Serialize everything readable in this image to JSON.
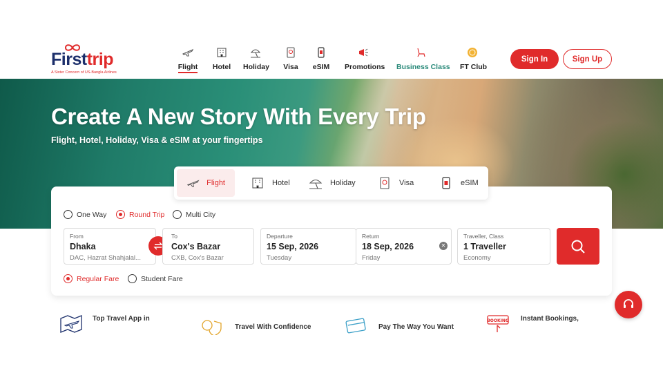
{
  "colors": {
    "brand_red": "#e02b2b",
    "brand_navy": "#1c2f6b",
    "business_teal": "#2a8a7a"
  },
  "brand": {
    "name_first": "First",
    "name_trip": "trip",
    "tagline": "A Sister Concern of US-Bangla Airlines"
  },
  "nav": {
    "items": [
      {
        "label": "Flight",
        "icon": "plane-icon"
      },
      {
        "label": "Hotel",
        "icon": "hotel-icon"
      },
      {
        "label": "Holiday",
        "icon": "beach-icon"
      },
      {
        "label": "Visa",
        "icon": "passport-icon"
      },
      {
        "label": "eSIM",
        "icon": "sim-icon"
      },
      {
        "label": "Promotions",
        "icon": "megaphone-icon"
      },
      {
        "label": "Business Class",
        "icon": "seat-icon"
      },
      {
        "label": "FT Club",
        "icon": "coin-icon"
      }
    ],
    "active": "Flight"
  },
  "auth": {
    "sign_in": "Sign In",
    "sign_up": "Sign Up"
  },
  "hero": {
    "title": "Create A New Story With Every Trip",
    "subtitle": "Flight, Hotel, Holiday, Visa & eSIM at your fingertips"
  },
  "search": {
    "tabs": [
      {
        "label": "Flight",
        "icon": "plane-icon"
      },
      {
        "label": "Hotel",
        "icon": "hotel-icon"
      },
      {
        "label": "Holiday",
        "icon": "beach-icon"
      },
      {
        "label": "Visa",
        "icon": "passport-icon"
      },
      {
        "label": "eSIM",
        "icon": "sim-icon"
      }
    ],
    "active_tab": "Flight",
    "trip_types": [
      "One Way",
      "Round Trip",
      "Multi City"
    ],
    "selected_trip_type": "Round Trip",
    "from": {
      "caption": "From",
      "city": "Dhaka",
      "airport": "DAC, Hazrat Shahjalal..."
    },
    "to": {
      "caption": "To",
      "city": "Cox's Bazar",
      "airport": "CXB, Cox's Bazar"
    },
    "departure": {
      "caption": "Departure",
      "date": "15 Sep, 2026",
      "day": "Tuesday"
    },
    "return": {
      "caption": "Return",
      "date": "18 Sep, 2026",
      "day": "Friday"
    },
    "traveller": {
      "caption": "Traveller, Class",
      "count": "1 Traveller",
      "class": "Economy"
    },
    "fares": [
      "Regular Fare",
      "Student Fare"
    ],
    "selected_fare": "Regular Fare"
  },
  "features": [
    {
      "label": "Top Travel App in",
      "icon": "map-plane-icon"
    },
    {
      "label": "Travel With Confidence",
      "icon": "shield-coins-icon"
    },
    {
      "label": "Pay The Way You Want",
      "icon": "card-icon"
    },
    {
      "label": "Instant Bookings,",
      "icon": "booking-icon"
    }
  ]
}
